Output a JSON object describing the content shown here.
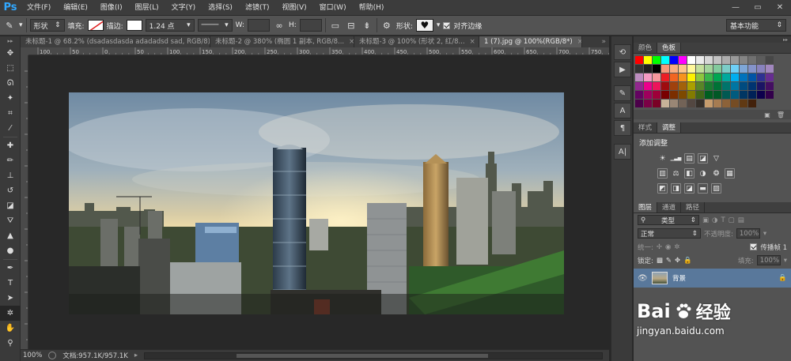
{
  "app": {
    "logo": "Ps",
    "workspace": "基本功能"
  },
  "menu": [
    "文件(F)",
    "编辑(E)",
    "图像(I)",
    "图层(L)",
    "文字(Y)",
    "选择(S)",
    "滤镜(T)",
    "视图(V)",
    "窗口(W)",
    "帮助(H)"
  ],
  "window_controls": {
    "minimize": "—",
    "maximize": "▭",
    "close": "✕"
  },
  "options": {
    "mode": "形状",
    "fill_label": "填充:",
    "stroke_label": "描边:",
    "stroke_width": "1.24 点",
    "w_label": "W:",
    "h_label": "H:",
    "shape_label": "形状:",
    "align_edges_label": "对齐边缘"
  },
  "doc_tabs": [
    {
      "title": "未标题-1 @ 68.2% (dsadasdasda adadadsd sad, RGB/8)...",
      "active": false
    },
    {
      "title": "未标题-2 @ 380% (椭圆 1 副本, RGB/8...",
      "active": false
    },
    {
      "title": "未标题-3 @ 100% (形状 2, 红/8...",
      "active": false
    },
    {
      "title": "1 (7).jpg @ 100%(RGB/8*)",
      "active": true
    }
  ],
  "ruler_labels": [
    "100",
    "50",
    "0",
    "50",
    "100",
    "150",
    "200",
    "250",
    "300",
    "350",
    "400",
    "450",
    "500",
    "550",
    "600",
    "650",
    "700",
    "750"
  ],
  "status": {
    "zoom": "100%",
    "doc_info": "文档:957.1K/957.1K"
  },
  "swatch_panel": {
    "tabs": [
      "颜色",
      "色板"
    ],
    "active_tab": 1,
    "colors": [
      "#ff0000",
      "#ffff00",
      "#00ff00",
      "#00ffff",
      "#0000ff",
      "#ff00ff",
      "#ffffff",
      "#ebebeb",
      "#d6d6d6",
      "#c2c2c2",
      "#adadad",
      "#999999",
      "#858585",
      "#707070",
      "#5c5c5c",
      "#474747",
      "#333333",
      "#1f1f1f",
      "#000000",
      "#f7977a",
      "#f9ad81",
      "#fdc68a",
      "#fff79a",
      "#c4df9b",
      "#a3d39c",
      "#82ca9d",
      "#7bcdc8",
      "#6ecff6",
      "#7ea7d8",
      "#8493ca",
      "#8882be",
      "#a187be",
      "#bc8dbf",
      "#f49ac2",
      "#f6989d",
      "#ed1c24",
      "#f26522",
      "#f7941d",
      "#fff200",
      "#8dc63f",
      "#39b54a",
      "#00a651",
      "#00a99d",
      "#00aeef",
      "#0072bc",
      "#0054a6",
      "#2e3192",
      "#662d91",
      "#92278f",
      "#ec008c",
      "#ed145b",
      "#9e0b0f",
      "#a0410d",
      "#a3620a",
      "#aba000",
      "#598527",
      "#1a7b30",
      "#007236",
      "#00746b",
      "#0076a3",
      "#004b80",
      "#003471",
      "#1b1464",
      "#440e62",
      "#630460",
      "#9e005d",
      "#9e0039",
      "#790000",
      "#7b2e00",
      "#7d4900",
      "#827b00",
      "#406618",
      "#005e20",
      "#005826",
      "#005952",
      "#005b7f",
      "#003663",
      "#002157",
      "#0d004c",
      "#32004b",
      "#4b0049",
      "#7b0046",
      "#7a0026",
      "#c7b299",
      "#998675",
      "#736357",
      "#534741",
      "#37302a",
      "#c69c6d",
      "#a67c52",
      "#8c6239",
      "#754c24",
      "#603913",
      "#42210b"
    ]
  },
  "adjust_panel": {
    "tabs": [
      "样式",
      "调整"
    ],
    "active_tab": 1,
    "title": "添加调整",
    "row1": [
      "☀",
      "▁▃▅",
      "▤",
      "◪",
      "▽"
    ],
    "row2": [
      "▥",
      "⚖",
      "◧",
      "◑",
      "❂",
      "▦"
    ],
    "row3": [
      "◩",
      "◨",
      "◪",
      "▬",
      "▨"
    ]
  },
  "layers_panel": {
    "tabs": [
      "图层",
      "通道",
      "路径"
    ],
    "active_tab": 0,
    "filter_kind": "类型",
    "blend_mode": "正常",
    "opacity_label": "不透明度:",
    "opacity_value": "100%",
    "unify_label": "统一:",
    "propagate_label": "传播帧 1",
    "lock_label": "锁定:",
    "fill_label": "填充:",
    "fill_value": "100%",
    "layer_name": "背景"
  },
  "watermark": {
    "brand": "Bai",
    "brand_cn": "经验",
    "url": "jingyan.baidu.com"
  }
}
